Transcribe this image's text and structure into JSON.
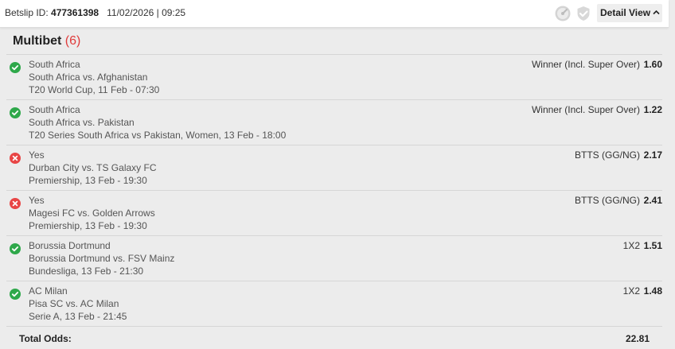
{
  "header": {
    "betslip_label": "Betslip ID:",
    "betslip_id": "477361398",
    "datetime": "11/02/2026 | 09:25",
    "detail_view_label": "Detail View",
    "icons": [
      "speedometer-icon",
      "shield-check-icon",
      "chevron-up-icon"
    ]
  },
  "section": {
    "title": "Multibet",
    "count": "(6)"
  },
  "colors": {
    "win": "#2ea84a",
    "loss": "#e84545",
    "count_accent": "#e03b3b"
  },
  "bets": [
    {
      "status": "won",
      "selection": "South Africa",
      "event": "South Africa vs. Afghanistan",
      "competition": "T20 World Cup, 11 Feb - 07:30",
      "market": "Winner (Incl. Super Over)",
      "odds": "1.60"
    },
    {
      "status": "won",
      "selection": "South Africa",
      "event": "South Africa vs. Pakistan",
      "competition": "T20 Series South Africa vs Pakistan, Women, 13 Feb - 18:00",
      "market": "Winner (Incl. Super Over)",
      "odds": "1.22"
    },
    {
      "status": "lost",
      "selection": "Yes",
      "event": "Durban City vs. TS Galaxy FC",
      "competition": "Premiership, 13 Feb - 19:30",
      "market": "BTTS (GG/NG)",
      "odds": "2.17"
    },
    {
      "status": "lost",
      "selection": "Yes",
      "event": "Magesi FC vs. Golden Arrows",
      "competition": "Premiership, 13 Feb - 19:30",
      "market": "BTTS (GG/NG)",
      "odds": "2.41"
    },
    {
      "status": "won",
      "selection": "Borussia Dortmund",
      "event": "Borussia Dortmund vs. FSV Mainz",
      "competition": "Bundesliga, 13 Feb - 21:30",
      "market": "1X2",
      "odds": "1.51"
    },
    {
      "status": "won",
      "selection": "AC Milan",
      "event": "Pisa SC vs. AC Milan",
      "competition": "Serie A, 13 Feb - 21:45",
      "market": "1X2",
      "odds": "1.48"
    }
  ],
  "total": {
    "label": "Total Odds:",
    "value": "22.81"
  }
}
